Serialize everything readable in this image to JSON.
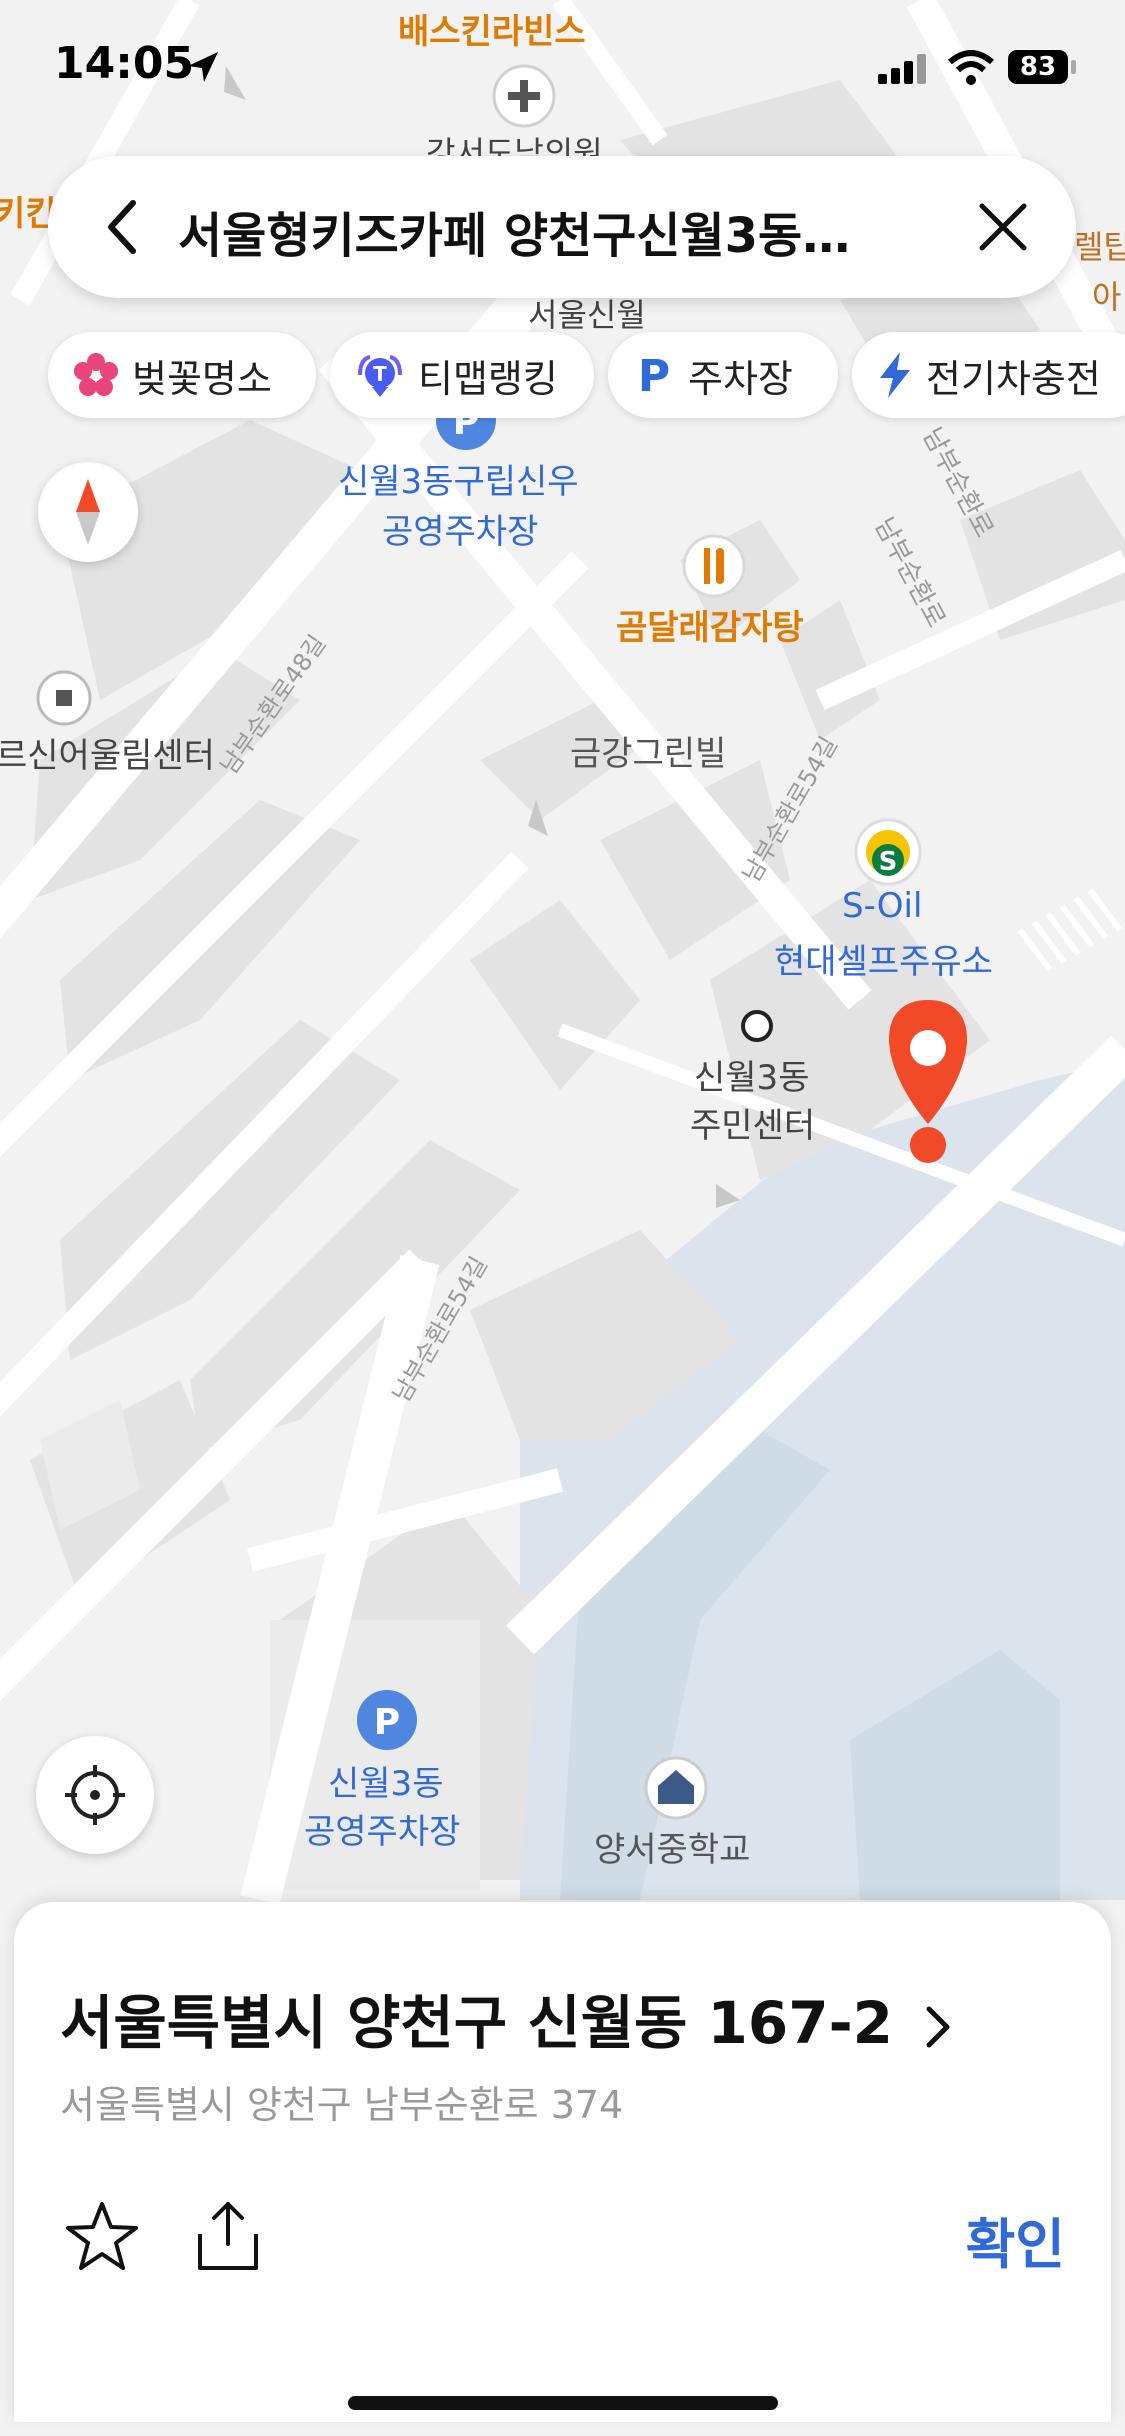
{
  "status_bar": {
    "time": "14:05",
    "battery": "83"
  },
  "search": {
    "query": "서울형키즈카페 양천구신월3동…"
  },
  "chips": [
    {
      "label": "벚꽃명소",
      "icon": "cherry-blossom-icon"
    },
    {
      "label": "티맵랭킹",
      "icon": "tmap-ranking-icon"
    },
    {
      "label": "주차장",
      "icon": "parking-icon"
    },
    {
      "label": "전기차충전",
      "icon": "lightning-icon"
    }
  ],
  "map_labels": {
    "top_orange": "배스킨라빈스",
    "hospital": "강서도남의원",
    "left_edge_orange": "키킨",
    "right_edge_1": "렐탑",
    "right_edge_2": "아",
    "seoul_partial": "서울신월",
    "parking_1_line1": "신월3동구립신우",
    "parking_1_line2": "공영주차장",
    "restaurant": "곰달래감자탕",
    "welfare_center": "르신어울림센터",
    "villa": "금강그린빌",
    "gas_line1": "S-Oil",
    "gas_line2": "현대셀프주유소",
    "community_line1": "신월3동",
    "community_line2": "주민센터",
    "parking_2_line1": "신월3동",
    "parking_2_line2": "공영주차장",
    "school": "양서중학교",
    "road_48": "남부순환로48길",
    "road_54_upper": "남부순환로54길",
    "road_54_lower": "남부순환로54길",
    "road_main_1": "남부순환로",
    "road_main_2": "남부순환로"
  },
  "place": {
    "address": "서울특별시 양천구 신월동 167-2",
    "road_address": "서울특별시 양천구 남부순환로 374",
    "confirm_label": "확인"
  },
  "colors": {
    "accent": "#2f6ad8",
    "pin": "#f04a28",
    "poi_orange": "#e07a00",
    "school_area": "#dde6ee"
  }
}
